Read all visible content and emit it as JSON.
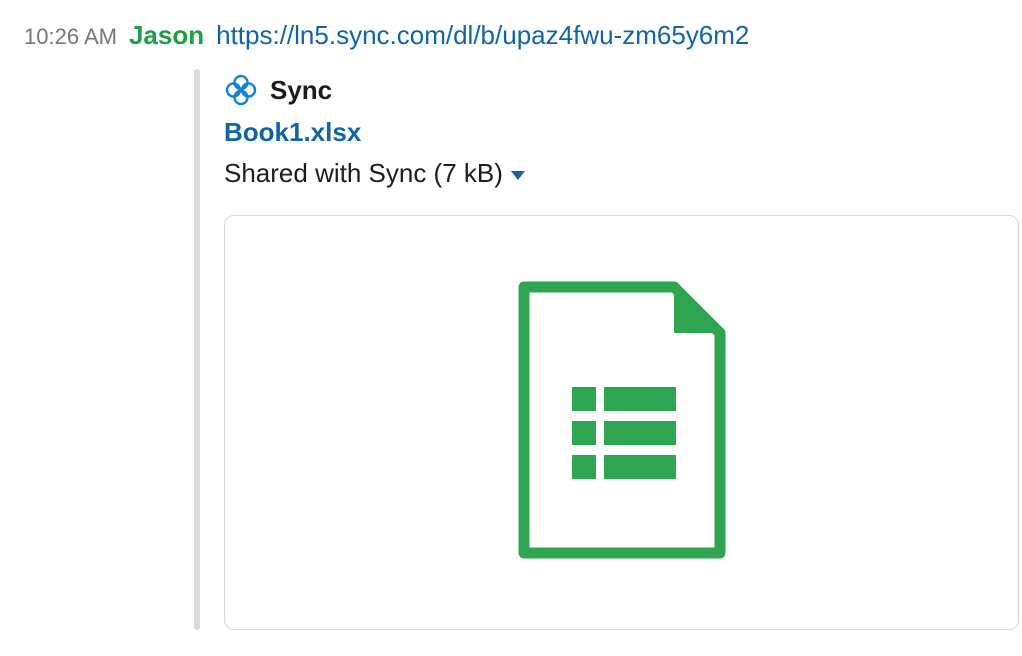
{
  "message": {
    "timestamp": "10:26 AM",
    "username": "Jason",
    "link_url": "https://ln5.sync.com/dl/b/upaz4fwu-zm65y6m2"
  },
  "attachment": {
    "source_name": "Sync",
    "file_name": "Book1.xlsx",
    "file_info": "Shared with Sync (7 kB)"
  }
}
